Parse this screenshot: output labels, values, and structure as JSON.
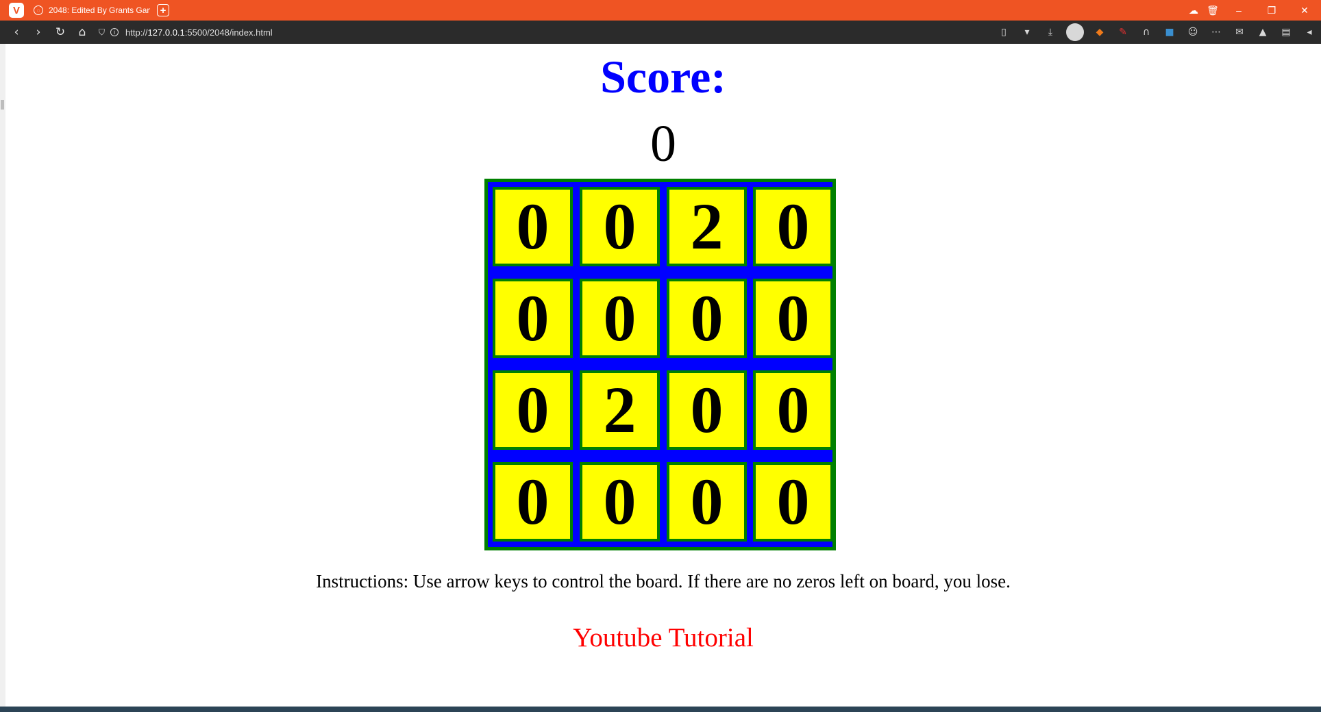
{
  "browser": {
    "tab_title": "2048: Edited By Grants Gan",
    "url_prefix": "http://",
    "url_host": "127.0.0.1",
    "url_path": ":5500/2048/index.html"
  },
  "page": {
    "score_label": "Score:",
    "score_value": "0",
    "board": [
      [
        "0",
        "0",
        "2",
        "0"
      ],
      [
        "0",
        "0",
        "0",
        "0"
      ],
      [
        "0",
        "2",
        "0",
        "0"
      ],
      [
        "0",
        "0",
        "0",
        "0"
      ]
    ],
    "instructions": "Instructions: Use arrow keys to control the board. If there are no zeros left on board, you lose.",
    "tutorial_link": "Youtube Tutorial"
  },
  "colors": {
    "browser_accent": "#ef5423",
    "toolbar": "#2b2b2b",
    "score_label": "#0000ff",
    "board_bg": "#0000ff",
    "board_border": "#008000",
    "tile_bg": "#ffff00",
    "link": "#ff0000"
  },
  "icons": {
    "toolbar": [
      "back-icon",
      "forward-icon",
      "reload-icon",
      "home-icon",
      "shield-icon",
      "info-icon"
    ],
    "extensions": [
      "bookmark-icon",
      "download-icon",
      "profile-avatar",
      "extension-icons"
    ]
  }
}
